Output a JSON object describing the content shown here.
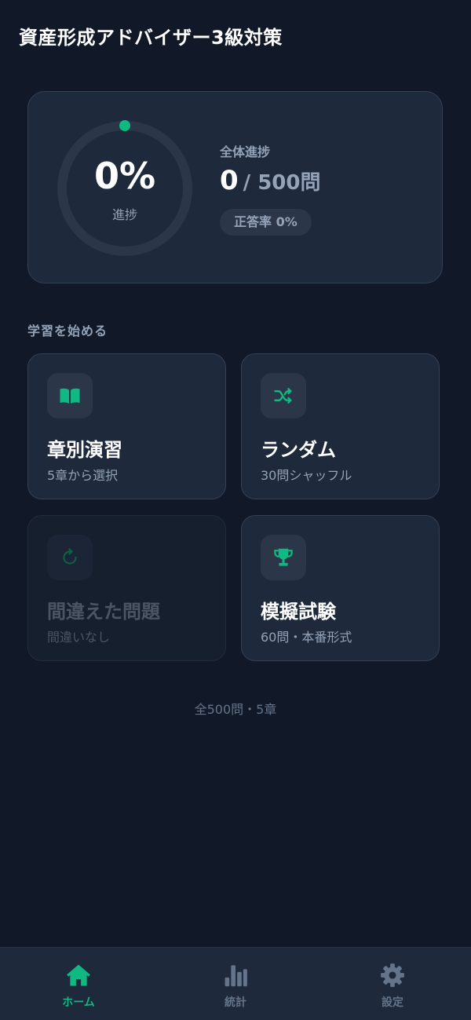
{
  "header": {
    "title": "資産形成アドバイザー3級対策"
  },
  "progress_card": {
    "percent_text": "0%",
    "percent_value": 0,
    "ring_label": "進捗",
    "overall_label": "全体進捗",
    "answered": "0",
    "total": "/ 500問",
    "accuracy": "正答率 0%"
  },
  "section": {
    "title": "学習を始める"
  },
  "tiles": [
    {
      "title": "章別演習",
      "subtitle": "5章から選択",
      "icon": "book-icon",
      "enabled": true
    },
    {
      "title": "ランダム",
      "subtitle": "30問シャッフル",
      "icon": "shuffle-icon",
      "enabled": true
    },
    {
      "title": "間違えた問題",
      "subtitle": "間違いなし",
      "icon": "retry-icon",
      "enabled": false
    },
    {
      "title": "模擬試験",
      "subtitle": "60問・本番形式",
      "icon": "trophy-icon",
      "enabled": true
    }
  ],
  "footer": {
    "note": "全500問・5章"
  },
  "bottom_nav": {
    "items": [
      {
        "label": "ホーム",
        "icon": "home-icon",
        "active": true
      },
      {
        "label": "統計",
        "icon": "bar-chart-icon",
        "active": false
      },
      {
        "label": "設定",
        "icon": "gear-icon",
        "active": false
      }
    ]
  },
  "colors": {
    "background": "#111827",
    "card": "#1e293b",
    "accent": "#10b981",
    "muted_text": "#94a3b8"
  }
}
